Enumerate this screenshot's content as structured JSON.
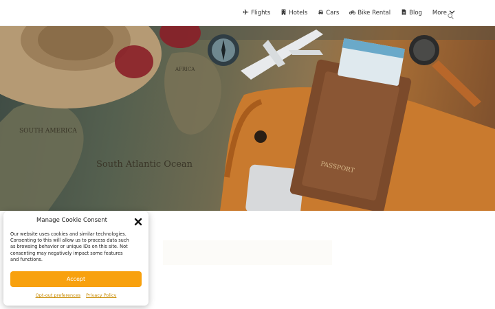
{
  "nav": {
    "items": [
      {
        "label": "Flights",
        "icon": "plane-icon"
      },
      {
        "label": "Hotels",
        "icon": "building-icon"
      },
      {
        "label": "Cars",
        "icon": "car-icon"
      },
      {
        "label": "Bike Rental",
        "icon": "bicycle-icon"
      },
      {
        "label": "Blog",
        "icon": "document-icon"
      },
      {
        "label": "More",
        "icon": "chevron-down-icon"
      }
    ],
    "search_icon": "search-icon"
  },
  "hero": {
    "map_labels": [
      "SOUTH AMERICA",
      "AFRICA",
      "South Atlantic Ocean"
    ],
    "passport_label": "PASSPORT"
  },
  "cookie": {
    "title": "Manage Cookie Consent",
    "text": "Our website uses cookies and similar technologies. Consenting to this will allow us to process data such as browsing behavior or unique IDs on this site. Not consenting may negatively impact some features and functions.",
    "accept_label": "Accept",
    "opt_out_label": "Opt-out preferences",
    "privacy_label": "Privacy Policy",
    "accent": "#f8a10e"
  }
}
